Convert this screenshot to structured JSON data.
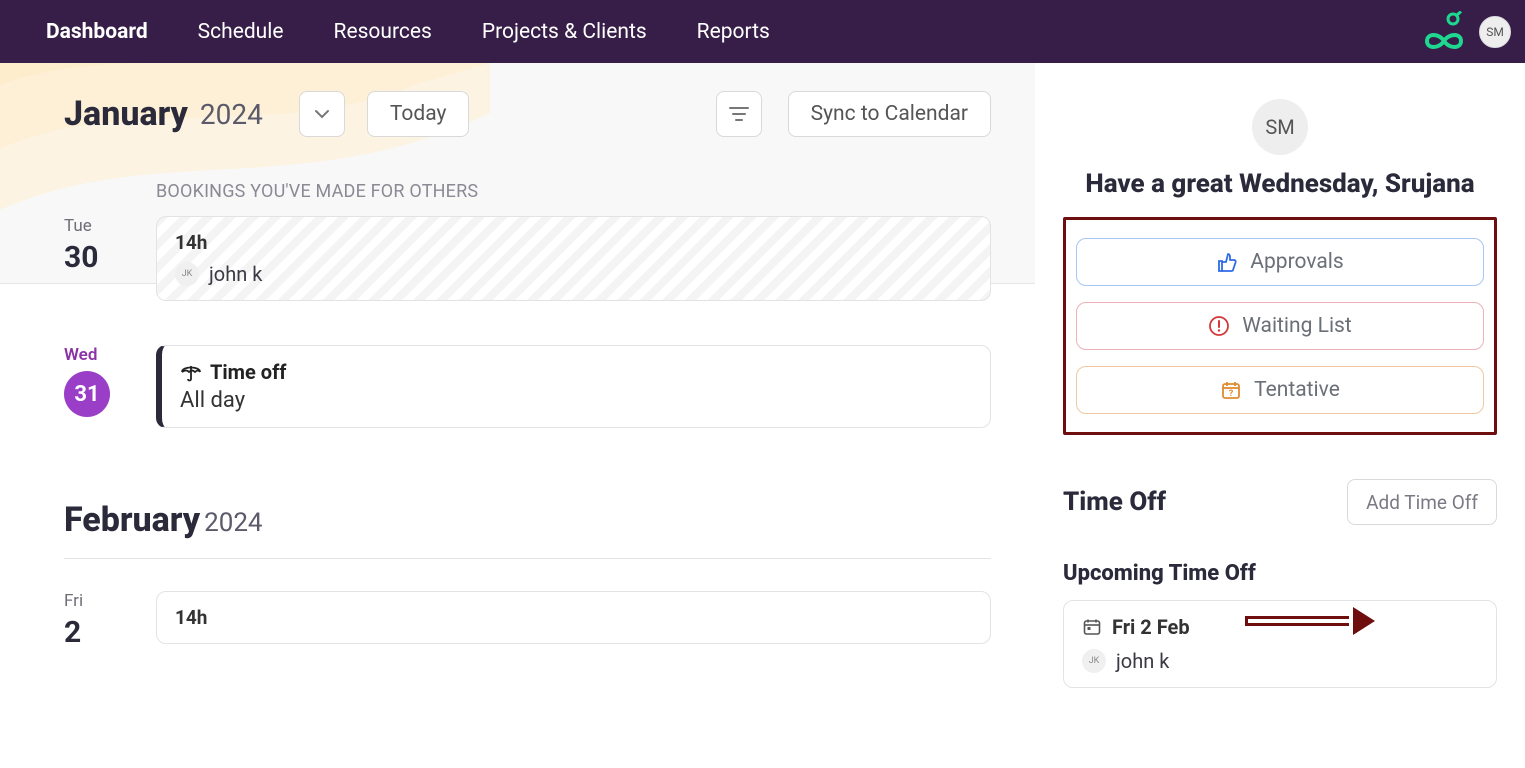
{
  "nav": {
    "items": [
      {
        "label": "Dashboard",
        "active": true
      },
      {
        "label": "Schedule",
        "active": false
      },
      {
        "label": "Resources",
        "active": false
      },
      {
        "label": "Projects & Clients",
        "active": false
      },
      {
        "label": "Reports",
        "active": false
      }
    ],
    "avatar_initials": "SM"
  },
  "main": {
    "month1": {
      "name": "January",
      "year": "2024"
    },
    "today_label": "Today",
    "sync_label": "Sync to Calendar",
    "bookings_header": "BOOKINGS YOU'VE MADE FOR OTHERS",
    "day1": {
      "dow": "Tue",
      "num": "30",
      "card": {
        "hours": "14h",
        "person_initials": "JK",
        "person_name": "john k"
      }
    },
    "day2": {
      "dow": "Wed",
      "num": "31",
      "card": {
        "title": "Time off",
        "sub": "All day"
      }
    },
    "month2": {
      "name": "February",
      "year": "2024"
    },
    "day3": {
      "dow": "Fri",
      "num": "2",
      "card": {
        "hours": "14h"
      }
    }
  },
  "sidebar": {
    "avatar_initials": "SM",
    "greeting": "Have a great Wednesday, Srujana",
    "pills": {
      "approvals": "Approvals",
      "waiting": "Waiting List",
      "tentative": "Tentative"
    },
    "timeoff_header": "Time Off",
    "add_timeoff_label": "Add Time Off",
    "upcoming_header": "Upcoming Time Off",
    "upcoming_card": {
      "date": "Fri 2 Feb",
      "person_initials": "JK",
      "person_name": "john k"
    }
  }
}
